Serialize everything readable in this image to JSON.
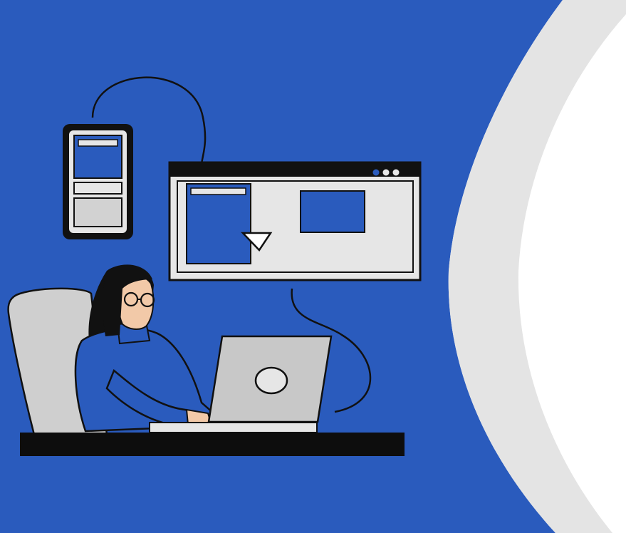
{
  "scene": {
    "description_free": true,
    "colors": {
      "background_blue": "#2a5bbd",
      "arc_gray": "#e4e4e4",
      "page_white": "#ffffff",
      "outline_black": "#111111",
      "panel_gray": "#e6e6e6",
      "laptop_gray": "#c8c8c8",
      "chair_gray": "#cfcfcf",
      "skin": "#f2c9a8",
      "hair": "#111111",
      "desk_black": "#0d0d0d"
    },
    "icons": {
      "phone": "smartphone-icon",
      "browser": "browser-window-icon",
      "cursor": "cursor-arrow-icon",
      "laptop": "laptop-icon",
      "person": "person-at-laptop-illustration"
    }
  }
}
